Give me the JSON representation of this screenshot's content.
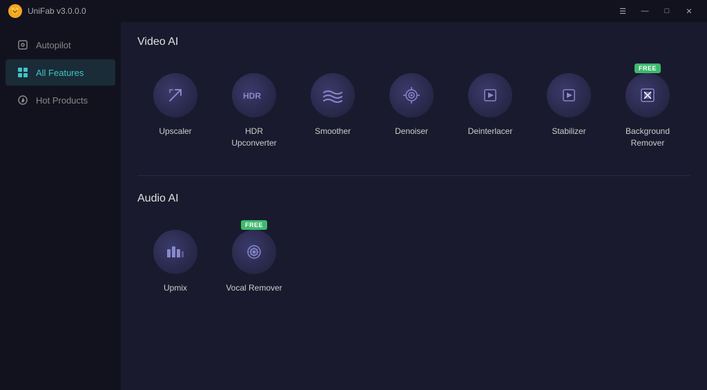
{
  "titleBar": {
    "appName": "UniFab v3.0.0.0",
    "controls": {
      "menu": "☰",
      "minimize": "—",
      "maximize": "□",
      "close": "✕"
    }
  },
  "sidebar": {
    "items": [
      {
        "id": "autopilot",
        "label": "Autopilot",
        "icon": "autopilot",
        "active": false
      },
      {
        "id": "all-features",
        "label": "All Features",
        "icon": "grid",
        "active": true
      },
      {
        "id": "hot-products",
        "label": "Hot Products",
        "icon": "fire",
        "active": false
      }
    ]
  },
  "content": {
    "videoAI": {
      "sectionTitle": "Video AI",
      "features": [
        {
          "id": "upscaler",
          "label": "Upscaler",
          "icon": "↗",
          "free": false
        },
        {
          "id": "hdr-upconverter",
          "label": "HDR Upconverter",
          "icon": "HDR",
          "free": false
        },
        {
          "id": "smoother",
          "label": "Smoother",
          "icon": "≋",
          "free": false
        },
        {
          "id": "denoiser",
          "label": "Denoiser",
          "icon": "⊙",
          "free": false
        },
        {
          "id": "deinterlacer",
          "label": "Deinterlacer",
          "icon": "▶",
          "free": false
        },
        {
          "id": "stabilizer",
          "label": "Stabilizer",
          "icon": "▶",
          "free": false
        },
        {
          "id": "bg-remover",
          "label": "Background\nRemover",
          "icon": "▣",
          "free": true
        }
      ]
    },
    "audioAI": {
      "sectionTitle": "Audio AI",
      "features": [
        {
          "id": "upmix",
          "label": "Upmix",
          "icon": "⊞",
          "free": false
        },
        {
          "id": "vocal-remover",
          "label": "Vocal Remover",
          "icon": "◉",
          "free": true
        }
      ]
    }
  }
}
